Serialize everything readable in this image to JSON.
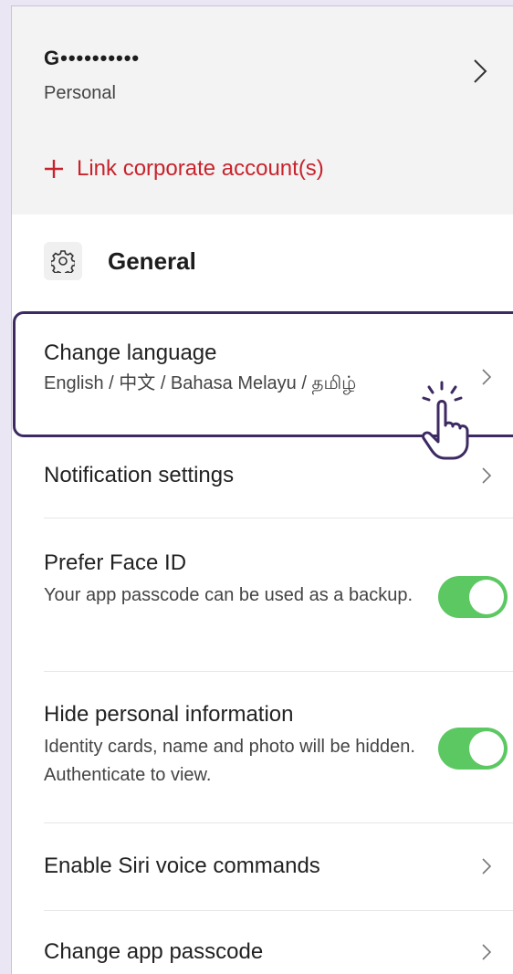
{
  "account": {
    "name": "G••••••••••",
    "type": "Personal",
    "link_corporate": "Link corporate account(s)"
  },
  "section": {
    "title": "General",
    "icon": "gear-icon"
  },
  "settings": {
    "change_language": {
      "title": "Change language",
      "subtitle": "English / 中文 / Bahasa Melayu / தமிழ்"
    },
    "notifications": {
      "title": "Notification settings"
    },
    "face_id": {
      "title": "Prefer Face ID",
      "subtitle": "Your app passcode can be used as a backup.",
      "enabled": true
    },
    "hide_info": {
      "title": "Hide personal information",
      "subtitle": "Identity cards, name and photo will be hidden. Authenticate to view.",
      "enabled": true
    },
    "siri": {
      "title": "Enable Siri voice commands"
    },
    "passcode": {
      "title": "Change app passcode"
    }
  },
  "colors": {
    "accent_red": "#c8232c",
    "toggle_on": "#5cc861",
    "highlight": "#3d2a63",
    "background": "#ebe6f3"
  }
}
